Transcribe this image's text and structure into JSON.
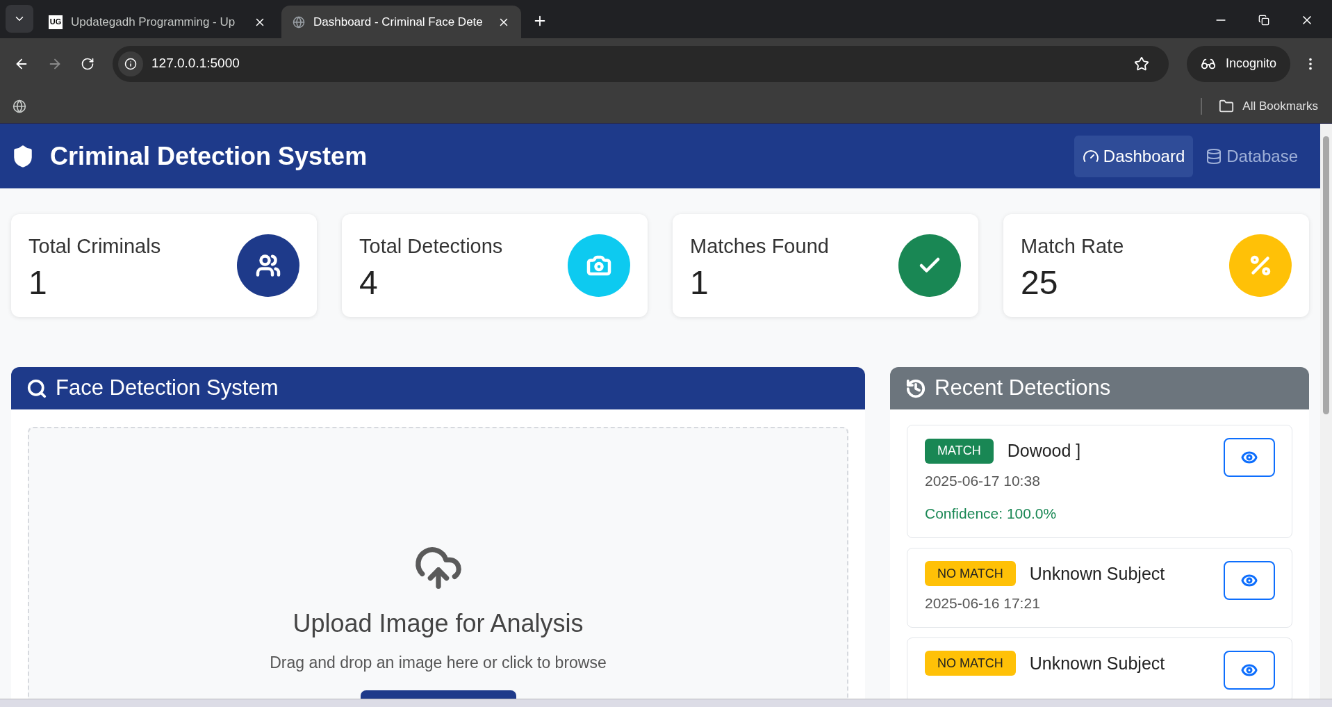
{
  "browser": {
    "tabs": [
      {
        "title": "Updategadh Programming - Up",
        "selected": false
      },
      {
        "title": "Dashboard - Criminal Face Dete",
        "selected": true
      }
    ],
    "logo_text": "UG",
    "url": "127.0.0.1:5000",
    "profile": "Incognito",
    "bookmarks": "All Bookmarks"
  },
  "navbar": {
    "brand": "Criminal Detection System",
    "links": [
      {
        "label": "Dashboard",
        "selected": true
      },
      {
        "label": "Database",
        "selected": false
      }
    ]
  },
  "stats": [
    {
      "label": "Total Criminals",
      "value": "1",
      "color": "#1e3a8a"
    },
    {
      "label": "Total Detections",
      "value": "4",
      "color": "#0dcaf0"
    },
    {
      "label": "Matches Found",
      "value": "1",
      "color": "#198754"
    },
    {
      "label": "Match Rate",
      "value": "25",
      "color": "#ffc107"
    }
  ],
  "detection_panel": {
    "title": "Face Detection System",
    "upload_title": "Upload Image for Analysis",
    "upload_hint": "Drag and drop an image here or click to browse"
  },
  "recent": {
    "title": "Recent Detections",
    "items": [
      {
        "status": "MATCH",
        "kind": "match",
        "name": "Dowood ]",
        "time": "2025-06-17 10:38",
        "confidence": "Confidence: 100.0%"
      },
      {
        "status": "NO MATCH",
        "kind": "no_match",
        "name": "Unknown Subject",
        "time": "2025-06-16 17:21"
      },
      {
        "status": "NO MATCH",
        "kind": "no_match",
        "name": "Unknown Subject"
      }
    ]
  }
}
